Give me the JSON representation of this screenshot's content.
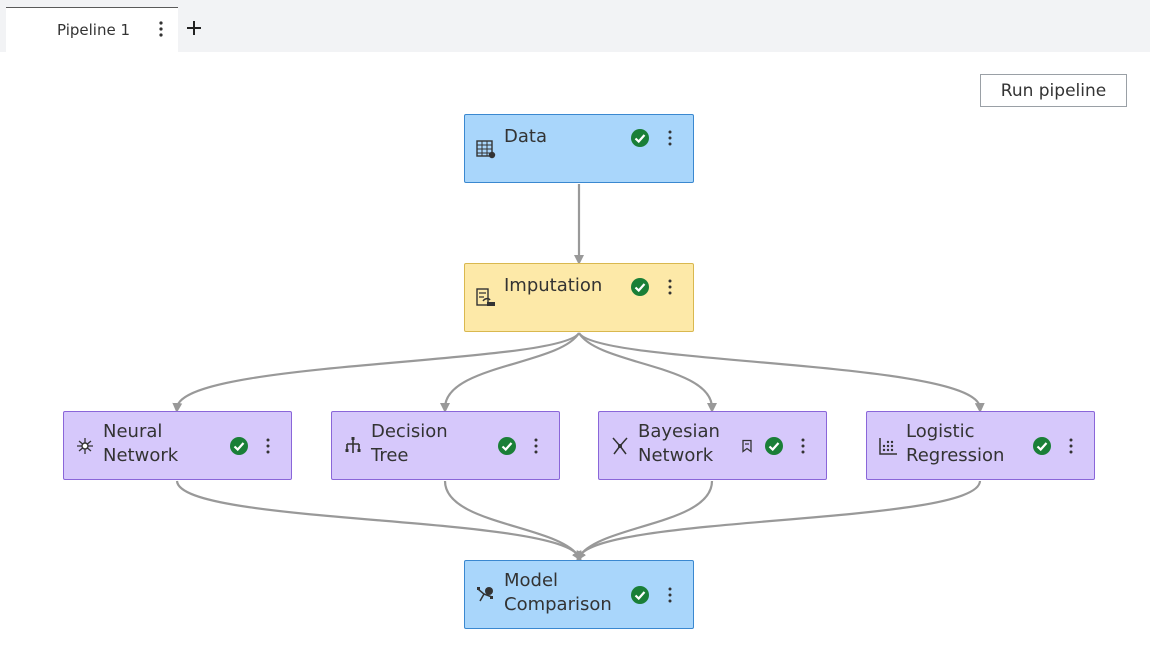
{
  "tabs": [
    {
      "label": "Pipeline 1"
    }
  ],
  "toolbar": {
    "run_label": "Run pipeline"
  },
  "colors": {
    "data_node": "#a9d6fb",
    "preprocess_node": "#fde9a8",
    "model_node": "#d6c8fb",
    "success": "#1a7f37",
    "edge": "#999999"
  },
  "nodes": {
    "data": {
      "label": "Data",
      "icon": "data-table-icon",
      "status": "success"
    },
    "imputation": {
      "label": "Imputation",
      "icon": "imputation-icon",
      "status": "success"
    },
    "neural_network": {
      "label": "Neural\nNetwork",
      "icon": "neural-network-icon",
      "status": "success"
    },
    "decision_tree": {
      "label": "Decision\nTree",
      "icon": "decision-tree-icon",
      "status": "success"
    },
    "bayesian_network": {
      "label": "Bayesian\nNetwork",
      "icon": "bayesian-network-icon",
      "status": "success",
      "extra_icon": "bookmark-icon"
    },
    "logistic_regression": {
      "label": "Logistic\nRegression",
      "icon": "logistic-regression-icon",
      "status": "success"
    },
    "model_comparison": {
      "label": "Model\nComparison",
      "icon": "model-comparison-icon",
      "status": "success"
    }
  }
}
